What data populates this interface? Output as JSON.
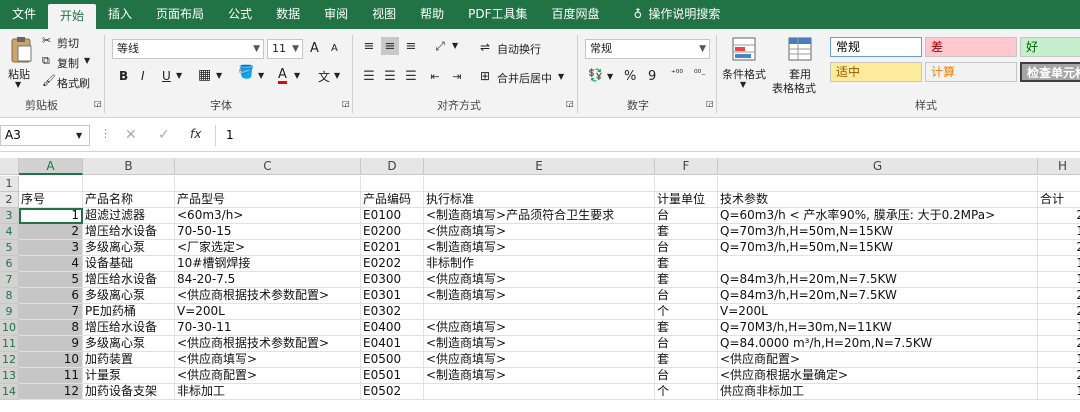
{
  "tabs": [
    "文件",
    "开始",
    "插入",
    "页面布局",
    "公式",
    "数据",
    "审阅",
    "视图",
    "帮助",
    "PDF工具集",
    "百度网盘",
    "操作说明搜索"
  ],
  "ribbon": {
    "clipboard": {
      "paste": "粘贴",
      "cut": "剪切",
      "copy": "复制",
      "format_painter": "格式刷",
      "label": "剪贴板"
    },
    "font": {
      "name": "等线",
      "size": "11",
      "label": "字体",
      "bold": "B",
      "italic": "I",
      "underline": "U",
      "grow": "A",
      "shrink": "A",
      "font_color": "A"
    },
    "align": {
      "wrap": "自动换行",
      "merge": "合并后居中",
      "label": "对齐方式"
    },
    "number": {
      "format": "常规",
      "label": "数字",
      "percent": "%",
      "comma": "9"
    },
    "styles": {
      "cond": "条件格式",
      "table_line1": "套用",
      "table_line2": "表格格式",
      "label": "样式",
      "cells": [
        {
          "text": "常规",
          "bg": "#ffffff",
          "color": "#000000"
        },
        {
          "text": "差",
          "bg": "#ffc7ce",
          "color": "#9c0006"
        },
        {
          "text": "好",
          "bg": "#c6efce",
          "color": "#006100"
        },
        {
          "text": "适中",
          "bg": "#ffeb9c",
          "color": "#9c5700"
        },
        {
          "text": "计算",
          "bg": "#f2f2f2",
          "color": "#fa7d00"
        },
        {
          "text": "检查单元格",
          "bg": "#a5a5a5",
          "color": "#ffffff"
        }
      ]
    }
  },
  "formula_bar": {
    "name_box": "A3",
    "fx": "fx",
    "value": "1"
  },
  "columns": [
    "A",
    "B",
    "C",
    "D",
    "E",
    "F",
    "G",
    "H"
  ],
  "rows": [
    "1",
    "2",
    "3",
    "4",
    "5",
    "6",
    "7",
    "8",
    "9",
    "10",
    "11",
    "12",
    "13",
    "14"
  ],
  "header_row": [
    "序号",
    "产品名称",
    "产品型号",
    "产品编码",
    "执行标准",
    "计量单位",
    "技术参数",
    "合计"
  ],
  "data": [
    [
      "1",
      "超滤过滤器",
      "<60m3/h>",
      "E0100",
      "<制造商填写>产品须符合卫生要求",
      "台",
      "Q=60m3/h < 产水率90%, 膜承压: 大于0.2MPa>",
      "2"
    ],
    [
      "2",
      "增压给水设备",
      "70-50-15",
      "E0200",
      "<供应商填写>",
      "套",
      "Q=70m3/h,H=50m,N=15KW",
      "1"
    ],
    [
      "3",
      "多级离心泵",
      "<厂家选定>",
      "E0201",
      "<制造商填写>",
      "台",
      "Q=70m3/h,H=50m,N=15KW",
      "2"
    ],
    [
      "4",
      "设备基础",
      "10#槽钢焊接",
      "E0202",
      "非标制作",
      "套",
      "",
      "1"
    ],
    [
      "5",
      "增压给水设备",
      "84-20-7.5",
      "E0300",
      "<供应商填写>",
      "套",
      "Q=84m3/h,H=20m,N=7.5KW",
      "1"
    ],
    [
      "6",
      "多级离心泵",
      "<供应商根据技术参数配置>",
      "E0301",
      "<制造商填写>",
      "台",
      "Q=84m3/h,H=20m,N=7.5KW",
      "2"
    ],
    [
      "7",
      "PE加药桶",
      "V=200L",
      "E0302",
      "",
      "个",
      "V=200L",
      "2"
    ],
    [
      "8",
      "增压给水设备",
      "70-30-11",
      "E0400",
      "<供应商填写>",
      "套",
      "Q=70M3/h,H=30m,N=11KW",
      "1"
    ],
    [
      "9",
      "多级离心泵",
      "<供应商根据技术参数配置>",
      "E0401",
      "<制造商填写>",
      "台",
      "Q=84.0000 m³/h,H=20m,N=7.5KW",
      "2"
    ],
    [
      "10",
      "加药装置",
      "<供应商填写>",
      "E0500",
      "<供应商填写>",
      "套",
      "<供应商配置>",
      "1"
    ],
    [
      "11",
      "计量泵",
      "<供应商配置>",
      "E0501",
      "<制造商填写>",
      "台",
      "<供应商根据水量确定>",
      "2"
    ],
    [
      "12",
      "加药设备支架",
      "非标加工",
      "E0502",
      "",
      "个",
      "供应商非标加工",
      "1"
    ]
  ]
}
